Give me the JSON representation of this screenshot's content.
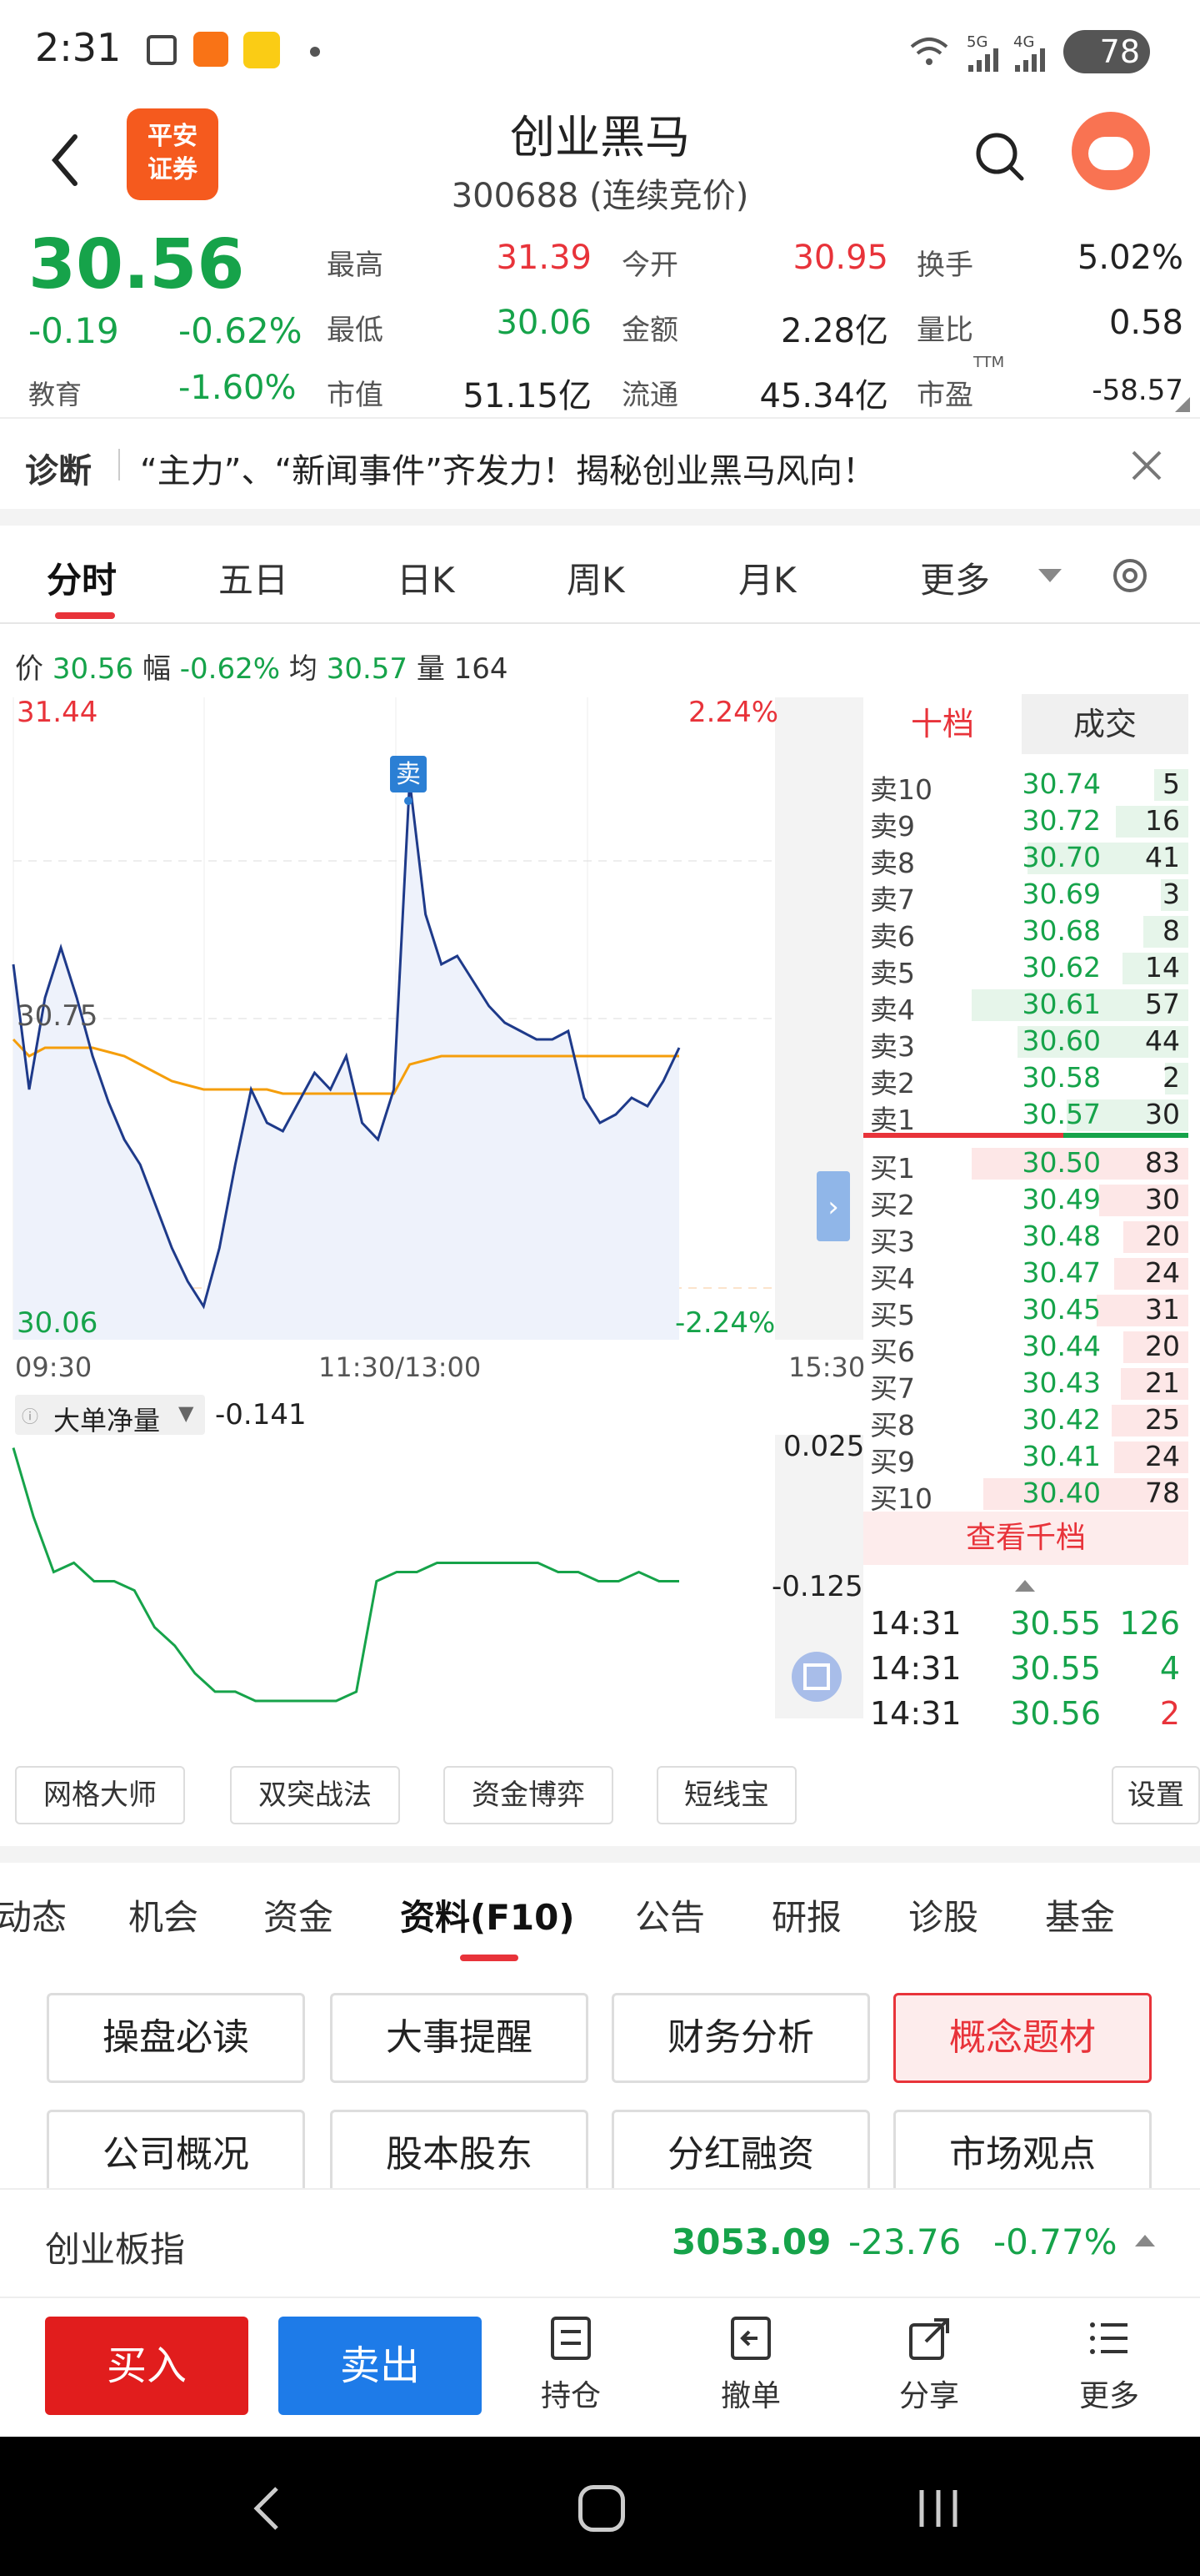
{
  "status": {
    "time": "2:31",
    "network1": "5G",
    "network2": "4G",
    "battery": "78"
  },
  "header": {
    "broker_logo_line1": "平安",
    "broker_logo_line2": "证券",
    "stock_name": "创业黑马",
    "stock_code": "300688 (连续竞价)"
  },
  "quote": {
    "price": "30.56",
    "change": "-0.19",
    "change_pct": "-0.62%",
    "sector": "教育",
    "sector_pct": "-1.60%",
    "high_label": "最高",
    "high": "31.39",
    "open_label": "今开",
    "open": "30.95",
    "turnover_label": "换手",
    "turnover": "5.02%",
    "low_label": "最低",
    "low": "30.06",
    "amount_label": "金额",
    "amount": "2.28亿",
    "volratio_label": "量比",
    "volratio": "0.58",
    "mcap_label": "市值",
    "mcap": "51.15亿",
    "float_label": "流通",
    "float": "45.34亿",
    "pe_label": "市盈",
    "pe_sup": "TTM",
    "pe": "-58.57"
  },
  "diagnosis": {
    "label": "诊断",
    "text": "“主力”、“新闻事件”齐发力！揭秘创业黑马风向！"
  },
  "chart_tabs": [
    "分时",
    "五日",
    "日K",
    "周K",
    "月K",
    "更多"
  ],
  "info_line": {
    "price_label": "价",
    "price": "30.56",
    "range_label": "幅",
    "range": "-0.62%",
    "avg_label": "均",
    "avg": "30.57",
    "vol_label": "量",
    "vol": "164"
  },
  "chart_data": {
    "type": "line",
    "y_top_label": "31.44",
    "y_bottom_label": "30.06",
    "pct_top_label": "2.24%",
    "pct_bottom_label": "-2.24%",
    "mid_label": "30.75",
    "x_labels": [
      "09:30",
      "11:30/13:00",
      "15:30"
    ],
    "sell_marker": "卖",
    "ylim": [
      30.06,
      31.44
    ],
    "series": [
      {
        "name": "价",
        "color": "#1e3a8a",
        "values": [
          30.88,
          30.58,
          30.8,
          30.92,
          30.8,
          30.66,
          30.55,
          30.46,
          30.4,
          30.3,
          30.2,
          30.12,
          30.06,
          30.2,
          30.4,
          30.58,
          30.5,
          30.48,
          30.55,
          30.62,
          30.58,
          30.66,
          30.5,
          30.46,
          30.58,
          31.32,
          31.0,
          30.88,
          30.9,
          30.84,
          30.78,
          30.74,
          30.72,
          30.7,
          30.7,
          30.72,
          30.56,
          30.5,
          30.52,
          30.56,
          30.54,
          30.6,
          30.68
        ]
      },
      {
        "name": "均",
        "color": "#f59e0b",
        "values": [
          30.7,
          30.66,
          30.68,
          30.68,
          30.68,
          30.68,
          30.67,
          30.66,
          30.64,
          30.62,
          30.6,
          30.59,
          30.58,
          30.58,
          30.58,
          30.58,
          30.58,
          30.57,
          30.57,
          30.57,
          30.57,
          30.57,
          30.57,
          30.57,
          30.57,
          30.64,
          30.65,
          30.66,
          30.66,
          30.66,
          30.66,
          30.66,
          30.66,
          30.66,
          30.66,
          30.66,
          30.66,
          30.66,
          30.66,
          30.66,
          30.66,
          30.66,
          30.66
        ]
      }
    ]
  },
  "sub_chart": {
    "label": "大单净量",
    "value": "-0.141",
    "top_label": "0.025",
    "mid_label": "-0.125",
    "values": [
      0.025,
      -0.05,
      -0.11,
      -0.1,
      -0.12,
      -0.12,
      -0.13,
      -0.17,
      -0.19,
      -0.22,
      -0.24,
      -0.24,
      -0.25,
      -0.25,
      -0.25,
      -0.25,
      -0.25,
      -0.24,
      -0.12,
      -0.11,
      -0.11,
      -0.1,
      -0.1,
      -0.1,
      -0.1,
      -0.1,
      -0.1,
      -0.11,
      -0.11,
      -0.12,
      -0.12,
      -0.11,
      -0.12,
      -0.12
    ]
  },
  "orderbook": {
    "tab_active": "十档",
    "tab_other": "成交",
    "asks": [
      {
        "label": "卖10",
        "price": "30.74",
        "vol": "5"
      },
      {
        "label": "卖9",
        "price": "30.72",
        "vol": "16"
      },
      {
        "label": "卖8",
        "price": "30.70",
        "vol": "41"
      },
      {
        "label": "卖7",
        "price": "30.69",
        "vol": "3"
      },
      {
        "label": "卖6",
        "price": "30.68",
        "vol": "8"
      },
      {
        "label": "卖5",
        "price": "30.62",
        "vol": "14"
      },
      {
        "label": "卖4",
        "price": "30.61",
        "vol": "57"
      },
      {
        "label": "卖3",
        "price": "30.60",
        "vol": "44"
      },
      {
        "label": "卖2",
        "price": "30.58",
        "vol": "2"
      },
      {
        "label": "卖1",
        "price": "30.57",
        "vol": "30"
      }
    ],
    "bids": [
      {
        "label": "买1",
        "price": "30.50",
        "vol": "83"
      },
      {
        "label": "买2",
        "price": "30.49",
        "vol": "30"
      },
      {
        "label": "买3",
        "price": "30.48",
        "vol": "20"
      },
      {
        "label": "买4",
        "price": "30.47",
        "vol": "24"
      },
      {
        "label": "买5",
        "price": "30.45",
        "vol": "31"
      },
      {
        "label": "买6",
        "price": "30.44",
        "vol": "20"
      },
      {
        "label": "买7",
        "price": "30.43",
        "vol": "21"
      },
      {
        "label": "买8",
        "price": "30.42",
        "vol": "25"
      },
      {
        "label": "买9",
        "price": "30.41",
        "vol": "24"
      },
      {
        "label": "买10",
        "price": "30.40",
        "vol": "78"
      }
    ],
    "view_more": "查看千档",
    "ticks": [
      {
        "time": "14:31",
        "price": "30.55",
        "vol": "126"
      },
      {
        "time": "14:31",
        "price": "30.55",
        "vol": "4"
      },
      {
        "time": "14:31",
        "price": "30.56",
        "vol": "2"
      }
    ]
  },
  "tools": [
    "网格大师",
    "双突战法",
    "资金博弈",
    "短线宝",
    "设置"
  ],
  "f10_tabs": [
    "动态",
    "机会",
    "资金",
    "资料(F10)",
    "公告",
    "研报",
    "诊股",
    "基金"
  ],
  "f10_buttons": [
    "操盘必读",
    "大事提醒",
    "财务分析",
    "概念题材",
    "公司概况",
    "股本股东",
    "分红融资",
    "市场观点"
  ],
  "index_bar": {
    "name": "创业板指",
    "value": "3053.09",
    "change": "-23.76",
    "pct": "-0.77%"
  },
  "trade_bar": {
    "buy": "买入",
    "sell": "卖出",
    "position": "持仓",
    "cancel": "撤单",
    "share": "分享",
    "more": "更多"
  }
}
